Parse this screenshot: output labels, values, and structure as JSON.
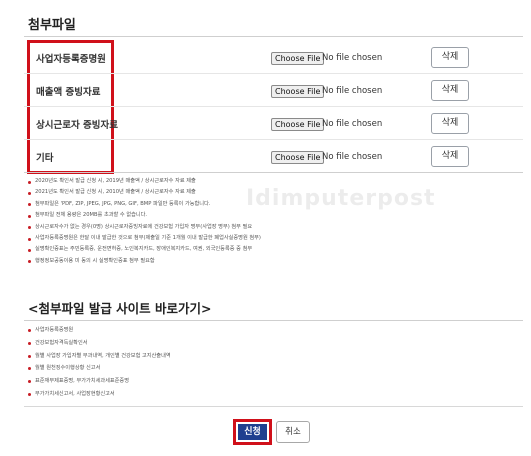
{
  "attachments": {
    "title": "첨부파일",
    "choose_label": "Choose File",
    "no_file_label": "No file chosen",
    "delete_label": "삭제",
    "rows": [
      {
        "label": "사업자등록증명원"
      },
      {
        "label": "매출액 증빙자료"
      },
      {
        "label": "상시근로자 증빙자료"
      },
      {
        "label": "기타"
      }
    ]
  },
  "notes": [
    "2020년도 확인서 발급 신청 시, 2019년 매출액 / 상시근로자수 자료 제출",
    "2021년도 확인서 발급 신청 시, 2010년 매출액 / 상시근로자수 자료 제출",
    "첨부파일은 'PDF, ZIP, JPEG, JPG, PNG, GIF, BMP 파일만 등록이 가능합니다.",
    "첨부파일 전체 용량은 20MB를 초과할 수 없습니다.",
    "상시근로자수가 없는 경우(0명) 상시근로자증빙자료에 건강보험 가입자 명부(사업장 명부) 첨부 필요",
    "사업자등록증명원은 한달 이내 발급한 것으로 첨부(제출일 기준 1개월 이내 발급한 폐업사실증명원 첨부)",
    "실명확인증표는 주민등록증, 운전면허증, 노인복지카드, 장애인복지카드, 여권, 외국인등록증 중 첨부",
    "행정정보공동이용 미 동의 시 실명확인증표 첨부 필요함"
  ],
  "shortcuts": {
    "title": "<첨부파일 발급 사이트 바로가기>",
    "items": [
      "사업자등록증명원",
      "건강보험자격득실확인서",
      "월별 사업장 가입자별 부과내역, 개인별 건강보험 고지산출내역",
      "월별 원천징수이행상황 신고서",
      "표준재무제표증명, 부가가치세과세표준증명",
      "부가가치세신고서, 사업장현황신고서"
    ]
  },
  "actions": {
    "apply_label": "신청",
    "cancel_label": "취소"
  },
  "watermark": "Idimputerpost",
  "colors": {
    "highlight": "#d0101a",
    "primary": "#1f3f8f",
    "bullet": "#c81d25"
  }
}
